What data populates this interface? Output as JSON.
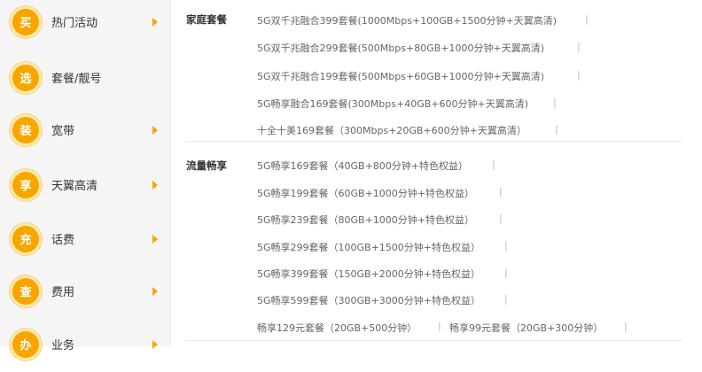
{
  "sidebar": {
    "items": [
      {
        "badge": "买",
        "label": "热门活动",
        "arrow": true
      },
      {
        "badge": "选",
        "label": "套餐/靓号",
        "arrow": false
      },
      {
        "badge": "装",
        "label": "宽带",
        "arrow": true
      },
      {
        "badge": "享",
        "label": "天翼高清",
        "arrow": true
      },
      {
        "badge": "充",
        "label": "话费",
        "arrow": true
      },
      {
        "badge": "查",
        "label": "费用",
        "arrow": true
      },
      {
        "badge": "办",
        "label": "业务",
        "arrow": true
      }
    ]
  },
  "groups": [
    {
      "title": "家庭套餐",
      "plans": [
        "5G双千兆融合399套餐(1000Mbps+100GB+1500分钟+天翼高清)",
        "5G双千兆融合299套餐(500Mbps+80GB+1000分钟+天翼高清)",
        "5G双千兆融合199套餐(500Mbps+60GB+1000分钟+天翼高清)",
        "5G畅享融合169套餐(300Mbps+40GB+600分钟+天翼高清)",
        "十全十美169套餐（300Mbps+20GB+600分钟+天翼高清）"
      ]
    },
    {
      "title": "流量畅享",
      "plans": [
        "5G畅享169套餐（40GB+800分钟+特色权益）",
        "5G畅享199套餐（60GB+1000分钟+特色权益）",
        "5G畅享239套餐（80GB+1000分钟+特色权益）",
        "5G畅享299套餐（100GB+1500分钟+特色权益）",
        "5G畅享399套餐（150GB+2000分钟+特色权益）",
        "5G畅享599套餐（300GB+3000分钟+特色权益）"
      ],
      "last_row": [
        "畅享129元套餐（20GB+500分钟）",
        "畅享99元套餐（20GB+300分钟）"
      ]
    }
  ],
  "separator": "|",
  "colors": {
    "accent": "#f7a600",
    "sidebar_bg": "#f5f5f5"
  }
}
